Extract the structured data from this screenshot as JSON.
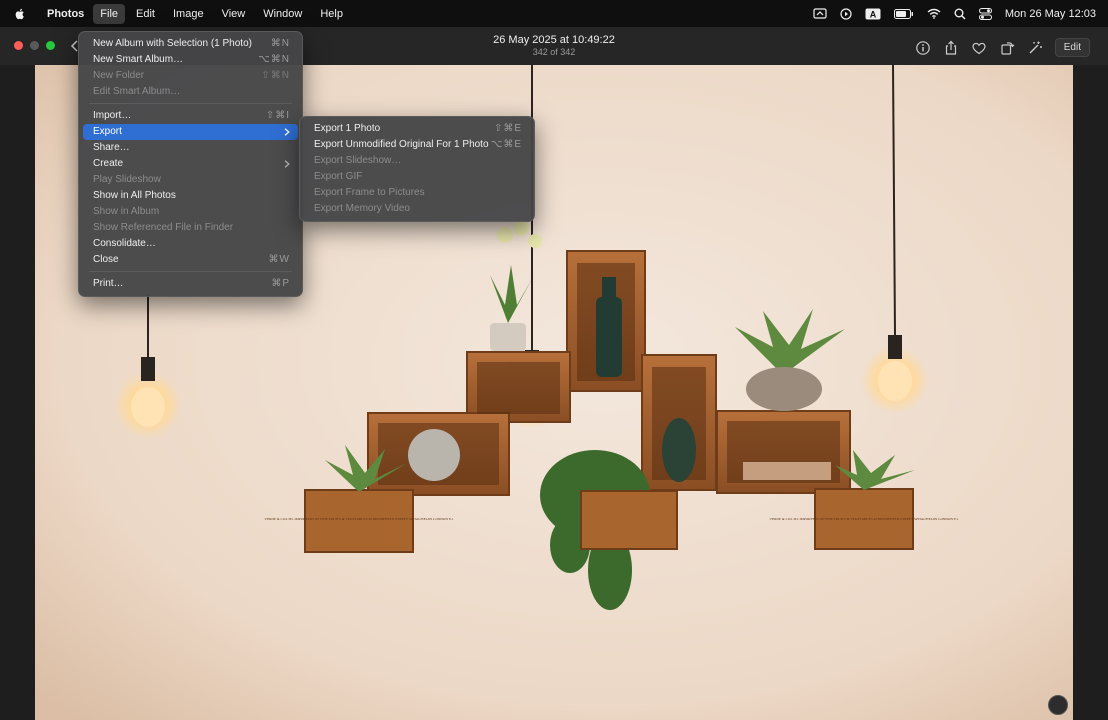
{
  "menubar": {
    "app_name": "Photos",
    "items": [
      "File",
      "Edit",
      "Image",
      "View",
      "Window",
      "Help"
    ],
    "clock": "Mon 26 May  12:03",
    "input_source": "A"
  },
  "toolbar": {
    "title_date": "26 May 2025 at 10:49:22",
    "title_count": "342 of 342",
    "edit_label": "Edit"
  },
  "file_menu": {
    "items": [
      {
        "label": "New Album with Selection (1 Photo)",
        "shortcut": "⌘N"
      },
      {
        "label": "New Smart Album…",
        "shortcut": "⌥⌘N"
      },
      {
        "label": "New Folder",
        "shortcut": "⇧⌘N"
      },
      {
        "label": "Edit Smart Album…",
        "shortcut": ""
      },
      {
        "label": "Import…",
        "shortcut": "⇧⌘I"
      },
      {
        "label": "Export",
        "shortcut": ""
      },
      {
        "label": "Share…",
        "shortcut": ""
      },
      {
        "label": "Create",
        "shortcut": ""
      },
      {
        "label": "Play Slideshow",
        "shortcut": ""
      },
      {
        "label": "Show in All Photos",
        "shortcut": ""
      },
      {
        "label": "Show in Album",
        "shortcut": ""
      },
      {
        "label": "Show Referenced File in Finder",
        "shortcut": ""
      },
      {
        "label": "Consolidate…",
        "shortcut": ""
      },
      {
        "label": "Close",
        "shortcut": "⌘W"
      },
      {
        "label": "Print…",
        "shortcut": "⌘P"
      }
    ]
  },
  "export_menu": {
    "items": [
      {
        "label": "Export 1 Photo",
        "shortcut": "⇧⌘E"
      },
      {
        "label": "Export Unmodified Original For 1 Photo",
        "shortcut": "⌥⌘E"
      },
      {
        "label": "Export Slideshow…",
        "shortcut": ""
      },
      {
        "label": "Export GIF",
        "shortcut": ""
      },
      {
        "label": "Export Frame to Pictures",
        "shortcut": ""
      },
      {
        "label": "Export Memory Video",
        "shortcut": ""
      }
    ]
  },
  "photo": {
    "crate_left_text": "VERDE & CO.LTD. IMPORTERS OF FINE FRUITS & VEGETABLES 40 BRUSHFIELD STREET SPITALFIELDS LONDON E.1",
    "crate_right_text": "VERDE & CO.LTD. IMPORTERS OF FINE FRUITS & VEGETABLES 40 BRUSHFIELD STREET SPITALFIELDS LONDON E.1"
  },
  "colors": {
    "menubar_bg": "#0f0f0f",
    "highlight": "#2f6ed3",
    "close_red": "#ff5f57",
    "minimize_gray": "#5a5a5a",
    "zoom_green": "#28c840"
  },
  "icons": [
    "apple-icon",
    "screen-mirroring-icon",
    "play-icon",
    "input-source-icon",
    "battery-icon",
    "wifi-icon",
    "search-icon",
    "control-center-icon",
    "info-icon",
    "share-icon",
    "heart-icon",
    "rotate-icon",
    "enhance-icon",
    "chevron-right-icon",
    "back-chevron-icon",
    "live-text-icon"
  ]
}
